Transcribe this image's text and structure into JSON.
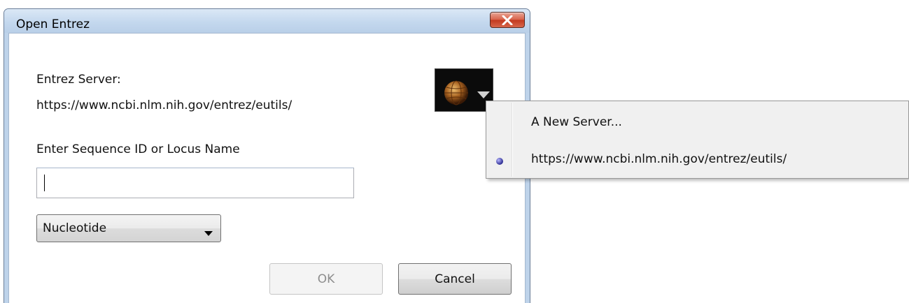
{
  "window": {
    "title": "Open Entrez"
  },
  "dialog": {
    "server_label": "Entrez Server:",
    "server_url": "https://www.ncbi.nlm.nih.gov/entrez/eutils/",
    "sequence_label": "Enter Sequence ID or Locus Name",
    "sequence_value": "",
    "database_select": {
      "selected": "Nucleotide"
    },
    "ok_label": "OK",
    "cancel_label": "Cancel"
  },
  "server_menu": {
    "items": [
      {
        "label": "A New Server...",
        "checked": false
      },
      {
        "label": "https://www.ncbi.nlm.nih.gov/entrez/eutils/",
        "checked": true
      }
    ]
  },
  "colors": {
    "title_bar": "#c4d8ee",
    "close_button": "#d9634b",
    "radio_dot": "#3a3aa8"
  }
}
